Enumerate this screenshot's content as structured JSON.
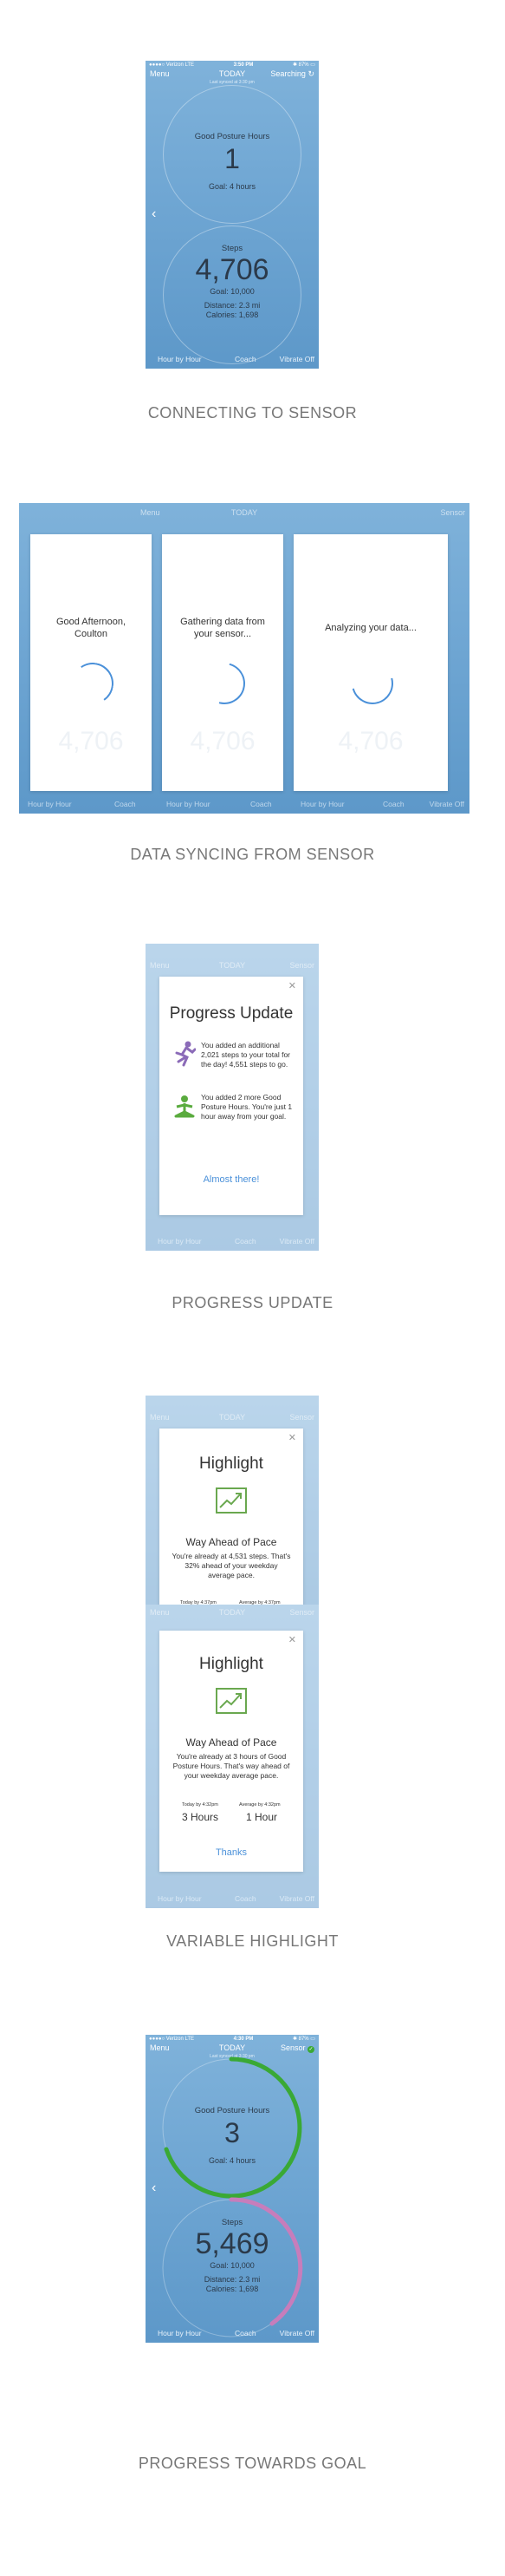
{
  "status": {
    "carrier": "●●●●○ Verizon  LTE",
    "time_s1": "3:50 PM",
    "time_s5": "4:30 PM",
    "battery": "✱ 87% ▭"
  },
  "nav": {
    "menu": "Menu",
    "today": "TODAY",
    "searching": "Searching",
    "sensor": "Sensor"
  },
  "last_synced": "Last synced at 3:30 pm",
  "posture": {
    "label": "Good Posture Hours",
    "value_s1": "1",
    "value_s5": "3",
    "goal": "Goal: 4 hours"
  },
  "steps": {
    "label": "Steps",
    "value_s1": "4,706",
    "value_s5": "5,469",
    "goal": "Goal: 10,000",
    "distance": "Distance: 2.3 mi",
    "calories": "Calories: 1,698"
  },
  "bottom": {
    "hour": "Hour by Hour",
    "coach": "Coach",
    "vibrate": "Vibrate Off"
  },
  "captions": {
    "c1": "CONNECTING TO SENSOR",
    "c2": "DATA SYNCING FROM SENSOR",
    "c3": "PROGRESS UPDATE",
    "c4": "VARIABLE HIGHLIGHT",
    "c5": "PROGRESS TOWARDS GOAL"
  },
  "sync": {
    "panel1": "Good Afternoon, Coulton",
    "panel2": "Gathering data from your sensor...",
    "panel3": "Analyzing your data...",
    "bg_steps": "4,706"
  },
  "progress_update": {
    "title": "Progress Update",
    "item1": "You added an additional 2,021 steps to your total for the day! 4,551 steps to go.",
    "item2": "You added 2 more Good Posture Hours. You're just 1 hour away from your goal.",
    "link": "Almost there!"
  },
  "highlight1": {
    "title": "Highlight",
    "subtitle": "Way Ahead of Pace",
    "body": "You're already at 4,531 steps. That's 32% ahead of your weekday average pace.",
    "stat1_label": "Today by 4:37pm",
    "stat2_label": "Average by 4:37pm"
  },
  "highlight2": {
    "title": "Highlight",
    "subtitle": "Way Ahead of Pace",
    "body": "You're already at 3 hours of Good Posture Hours. That's way ahead of your weekday average pace.",
    "stat1_label": "Today by 4:32pm",
    "stat2_label": "Average by 4:32pm",
    "stat1_value": "3 Hours",
    "stat2_value": "1 Hour",
    "link": "Thanks"
  },
  "colors": {
    "posture_ring": "#3aa935",
    "steps_ring": "#c77dbb",
    "accent": "#4a90d9",
    "runner": "#8b6bb8",
    "yoga": "#5aab3e"
  }
}
